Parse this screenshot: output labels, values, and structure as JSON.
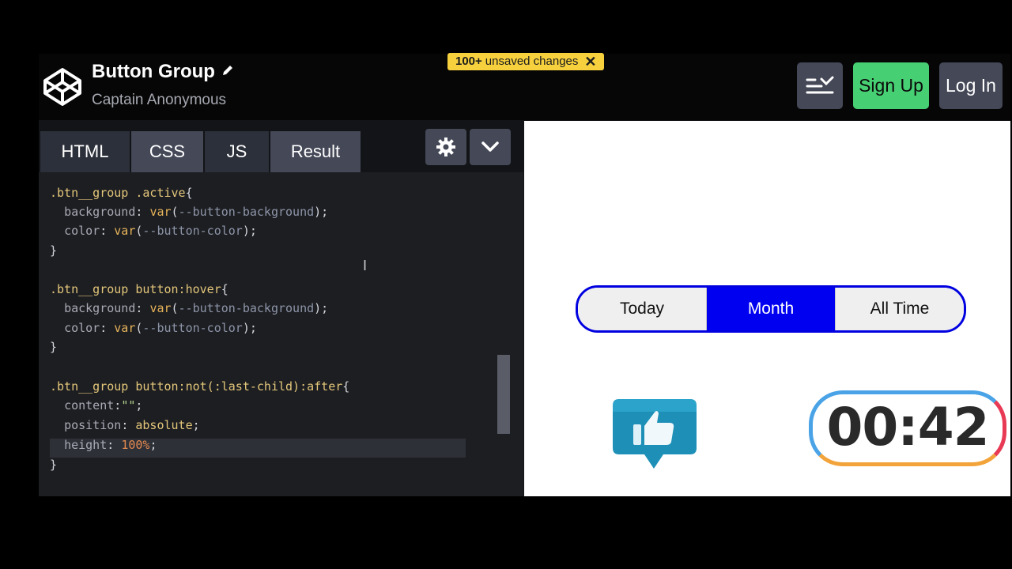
{
  "header": {
    "title": "Button Group",
    "author": "Captain Anonymous",
    "unsaved_count": "100+",
    "unsaved_label": "unsaved changes",
    "signup_label": "Sign Up",
    "login_label": "Log In"
  },
  "tabs": [
    {
      "label": "HTML"
    },
    {
      "label": "CSS"
    },
    {
      "label": "JS"
    },
    {
      "label": "Result"
    }
  ],
  "code_lines": [
    ".btn__group .active{",
    "  background: var(--button-background);",
    "  color: var(--button-color);",
    "}",
    "",
    ".btn__group button:hover{",
    "  background: var(--button-background);",
    "  color: var(--button-color);",
    "}",
    "",
    ".btn__group button:not(:last-child):after{",
    "  content:\"\";",
    "  position: absolute;",
    "  height: 100%;",
    "}"
  ],
  "preview": {
    "buttons": [
      {
        "label": "Today",
        "active": false
      },
      {
        "label": "Month",
        "active": true
      },
      {
        "label": "All Time",
        "active": false
      }
    ],
    "timer": "00:42"
  },
  "colors": {
    "signup": "#47cf73",
    "active_button": "#0000f0",
    "unsaved_badge": "#f7d13d"
  },
  "icons": [
    "codepen-logo-icon",
    "pencil-icon",
    "layout-icon",
    "gear-icon",
    "chevron-down-icon",
    "close-icon",
    "thumbs-up-icon",
    "text-cursor-icon"
  ]
}
